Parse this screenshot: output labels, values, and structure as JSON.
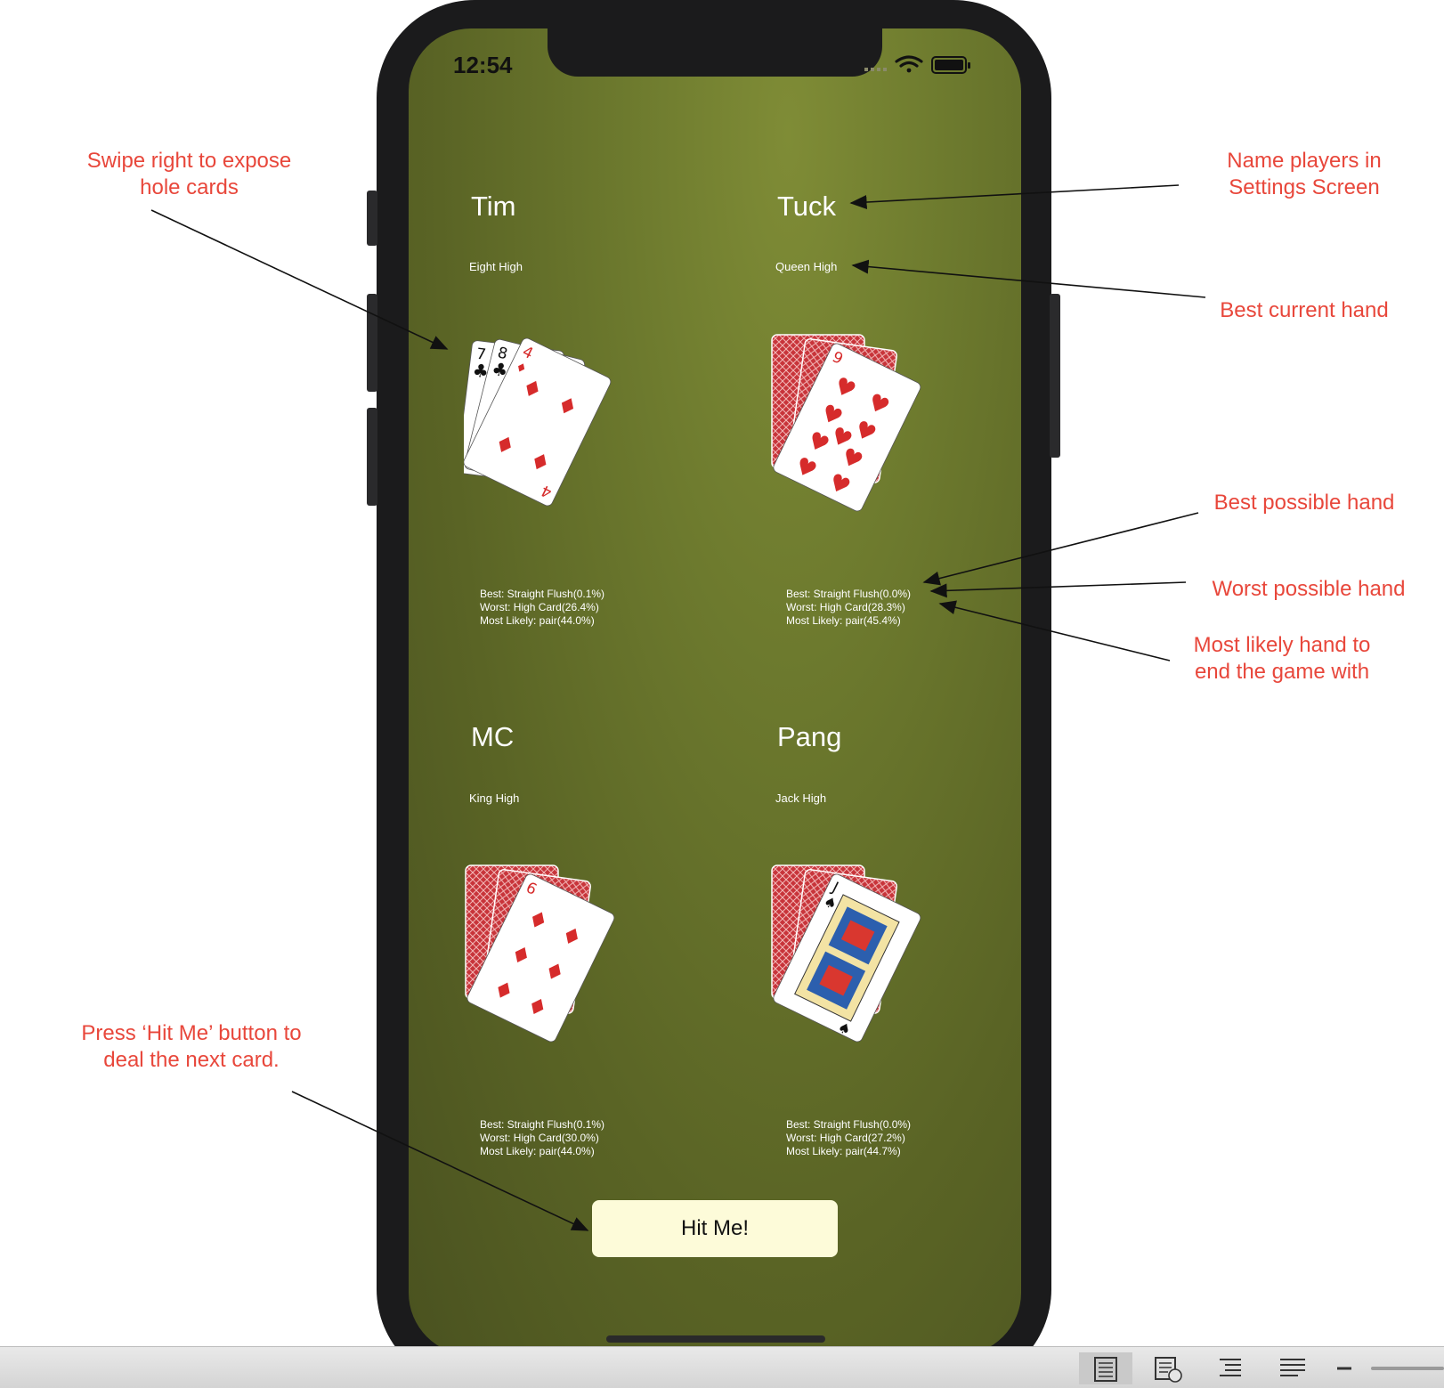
{
  "status_bar": {
    "time": "12:54"
  },
  "players": [
    {
      "name": "Tim",
      "current_hand": "Eight High",
      "best": "Best: Straight Flush(0.1%)",
      "worst": "Worst: High Card(26.4%)",
      "likely": "Most Likely: pair(44.0%)",
      "cards": [
        "7♣",
        "8♣",
        "4♦"
      ]
    },
    {
      "name": "Tuck",
      "current_hand": "Queen High",
      "best": "Best: Straight Flush(0.0%)",
      "worst": "Worst: High Card(28.3%)",
      "likely": "Most Likely: pair(45.4%)",
      "cards": [
        "back",
        "9♥"
      ]
    },
    {
      "name": "MC",
      "current_hand": "King High",
      "best": "Best: Straight Flush(0.1%)",
      "worst": "Worst: High Card(30.0%)",
      "likely": "Most Likely: pair(44.0%)",
      "cards": [
        "back",
        "6♦"
      ]
    },
    {
      "name": "Pang",
      "current_hand": "Jack High",
      "best": "Best: Straight Flush(0.0%)",
      "worst": "Worst: High Card(27.2%)",
      "likely": "Most Likely: pair(44.7%)",
      "cards": [
        "back",
        "J♠"
      ]
    }
  ],
  "hit_button": {
    "label": "Hit Me!"
  },
  "annotations": {
    "swipe_1": "Swipe right to expose",
    "swipe_2": "hole cards",
    "name_1": "Name players in",
    "name_2": "Settings Screen",
    "best_current": "Best current hand",
    "best_possible": "Best possible hand",
    "worst_possible": "Worst possible hand",
    "likely_1": "Most likely hand to",
    "likely_2": "end the game with",
    "hit_1": "Press ‘Hit Me’ button to",
    "hit_2": "deal the next card."
  },
  "colors": {
    "felt": "#5f6a27",
    "annotation": "#e8473b",
    "button": "#fdfbd9",
    "card_back": "#c8343a",
    "red_suit": "#d62b2b"
  }
}
